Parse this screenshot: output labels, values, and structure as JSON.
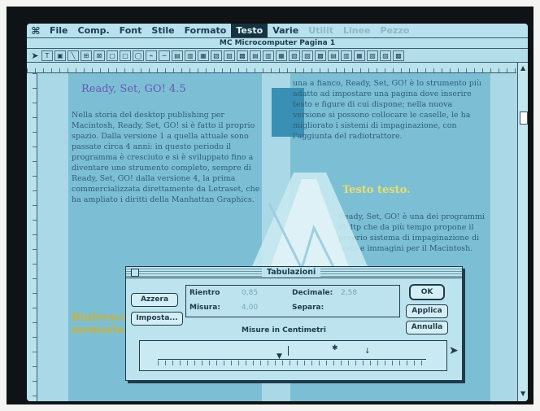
{
  "menubar": {
    "apple": "⌘",
    "items": [
      "File",
      "Comp.",
      "Font",
      "Stile",
      "Formato",
      "Testo",
      "Varie",
      "Utilit",
      "Linee",
      "Pezzo"
    ],
    "active_index": 5,
    "dim_from_index": 7
  },
  "window": {
    "title": "MC Microcomputer Pagina 1"
  },
  "document": {
    "heading": "Ready, Set, GO! 4.5",
    "left_body": "Nella storia del desktop publishing per Macintosh, Ready, Set, GO! si è fatto il proprio spazio. Dalla versione 1 a quella attuale sono passate circa 4 anni: in questo periodo il programma è cresciuto e si è sviluppato fino a diventare uno strumento completo, sempre di Ready, Set, GO! dalla versione 4, la prima commercializzata direttamente da Letraset, che ha ampliato i diritti della Manhattan Graphics.",
    "right_body": "una a fianco, Ready, Set, GO! è lo strumento più adatto ad impostare una pagina dove inserire testo e figure di cui dispone; nella nuova versione si possono collocare le caselle, le ha migliorato i sistemi di impaginazione, con l'aggiunta del radiotrattore.",
    "right_body2": "Ready, Set, GO! è una dei programmi di dtp che da più tempo propone il proprio sistema di impaginazione di testo e immagini per il Macintosh.",
    "yellow_text": "Testo testo.",
    "subhead": "Rinfresco la memoria"
  },
  "dialog": {
    "title": "Tabulazioni",
    "buttons": {
      "clear": "Azzera",
      "set": "Imposta...",
      "ok": "OK",
      "apply": "Applica",
      "cancel": "Annulla"
    },
    "fields": {
      "indent_label": "Rientro",
      "indent_value": "0,85",
      "measure_label": "Misura:",
      "measure_value": "4,00",
      "decimal_label": "Decimale:",
      "decimal_value": "2,58",
      "separator_label": "Separa:",
      "separator_value": ""
    },
    "caption": "Misure in Centimetri"
  }
}
